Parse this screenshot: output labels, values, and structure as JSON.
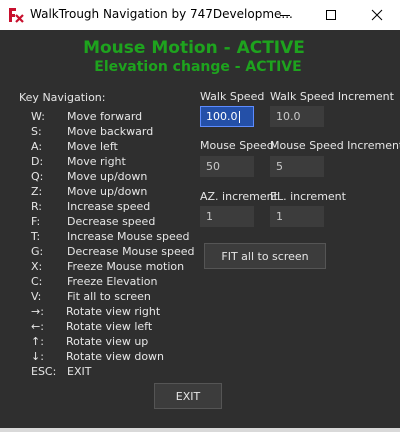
{
  "window": {
    "title": "WalkTrough Navigation by 747Developme...",
    "app_icon": "fx-app-icon",
    "controls": [
      "minimize-icon",
      "maximize-icon",
      "close-icon"
    ]
  },
  "status": {
    "mouse_motion": "Mouse Motion - ACTIVE",
    "elevation": "Elevation change - ACTIVE",
    "color": "#1ea31e"
  },
  "key_navigation": {
    "title": "Key Navigation:",
    "items": [
      {
        "key": "W:",
        "desc": "Move forward"
      },
      {
        "key": "S:",
        "desc": "Move backward"
      },
      {
        "key": "A:",
        "desc": "Move left"
      },
      {
        "key": "D:",
        "desc": "Move right"
      },
      {
        "key": "Q:",
        "desc": "Move up/down"
      },
      {
        "key": "Z:",
        "desc": "Move up/down"
      },
      {
        "key": "R:",
        "desc": "Increase speed"
      },
      {
        "key": "F:",
        "desc": "Decrease speed"
      },
      {
        "key": "T:",
        "desc": "Increase Mouse speed"
      },
      {
        "key": "G:",
        "desc": "Decrease Mouse speed"
      },
      {
        "key": "X:",
        "desc": "Freeze Mouse motion"
      },
      {
        "key": "C:",
        "desc": "Freeze Elevation"
      },
      {
        "key": "V:",
        "desc": "Fit all to screen"
      },
      {
        "key": "→:",
        "desc": "Rotate view right"
      },
      {
        "key": "←:",
        "desc": "Rotate view left"
      },
      {
        "key": "↑:",
        "desc": "Rotate view up"
      },
      {
        "key": "↓:",
        "desc": "Rotate view down"
      },
      {
        "key": "ESC:",
        "desc": "EXIT"
      }
    ]
  },
  "settings": {
    "walk_speed": {
      "label": "Walk Speed",
      "value": "100.0"
    },
    "walk_speed_increment": {
      "label": "Walk Speed Increment",
      "value": "10.0"
    },
    "mouse_speed": {
      "label": "Mouse Speed",
      "value": "50"
    },
    "mouse_speed_increment": {
      "label": "Mouse Speed Increment",
      "value": "5"
    },
    "az_increment": {
      "label": "AZ. increment",
      "value": "1"
    },
    "el_increment": {
      "label": "EL. increment",
      "value": "1"
    }
  },
  "buttons": {
    "fit_all": "FIT all to screen",
    "exit": "EXIT"
  }
}
